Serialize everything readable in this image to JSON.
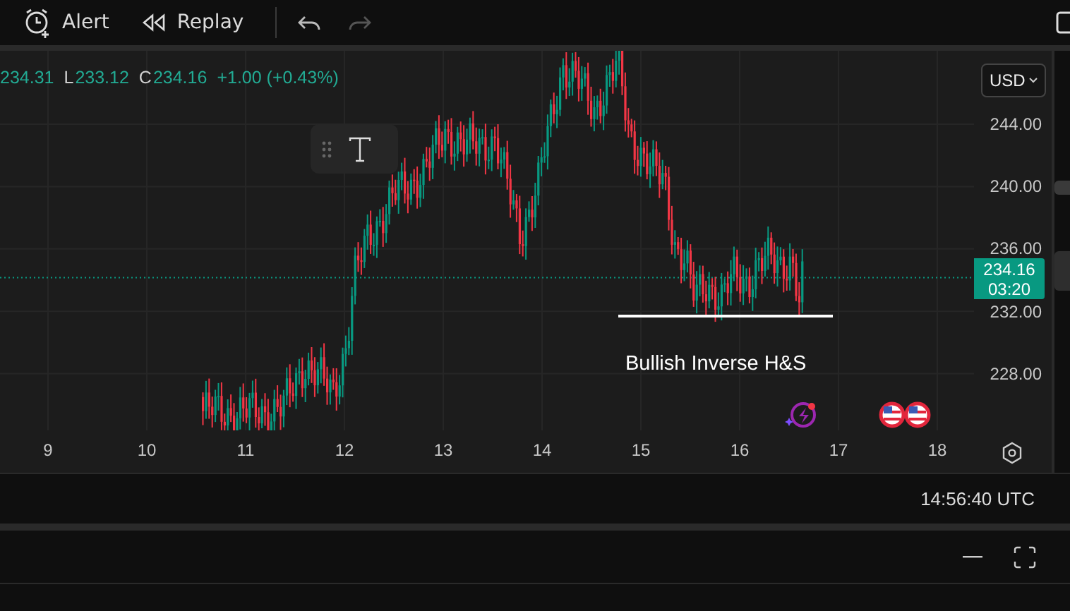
{
  "toolbar": {
    "buttons": [
      {
        "kind": "alert",
        "label": "Alert"
      },
      {
        "kind": "replay",
        "label": "Replay"
      }
    ],
    "history": [
      {
        "kind": "undo",
        "disabled": false
      },
      {
        "kind": "redo",
        "disabled": true
      }
    ]
  },
  "legend": [
    {
      "kind": "value",
      "text": "234.31"
    },
    {
      "kind": "key",
      "text": "L"
    },
    {
      "kind": "value",
      "text": "233.12"
    },
    {
      "kind": "key",
      "text": "C"
    },
    {
      "kind": "value",
      "text": "234.16"
    },
    {
      "kind": "value",
      "text": "+1.00 (+0.43%)"
    }
  ],
  "currency": "USD",
  "price_scale": [
    "244.00",
    "240.00",
    "236.00",
    "232.00",
    "228.00"
  ],
  "current_price": {
    "price": "234.16",
    "countdown": "03:20"
  },
  "time_scale": [
    "9",
    "10",
    "11",
    "12",
    "13",
    "14",
    "15",
    "16",
    "17",
    "18"
  ],
  "annotation": {
    "text": "Bullish Inverse H&S"
  },
  "events": [
    {
      "kind": "earnings"
    },
    {
      "kind": "economic"
    },
    {
      "kind": "economic"
    }
  ],
  "status_bar": {
    "clock": "14:56:40 UTC"
  }
}
